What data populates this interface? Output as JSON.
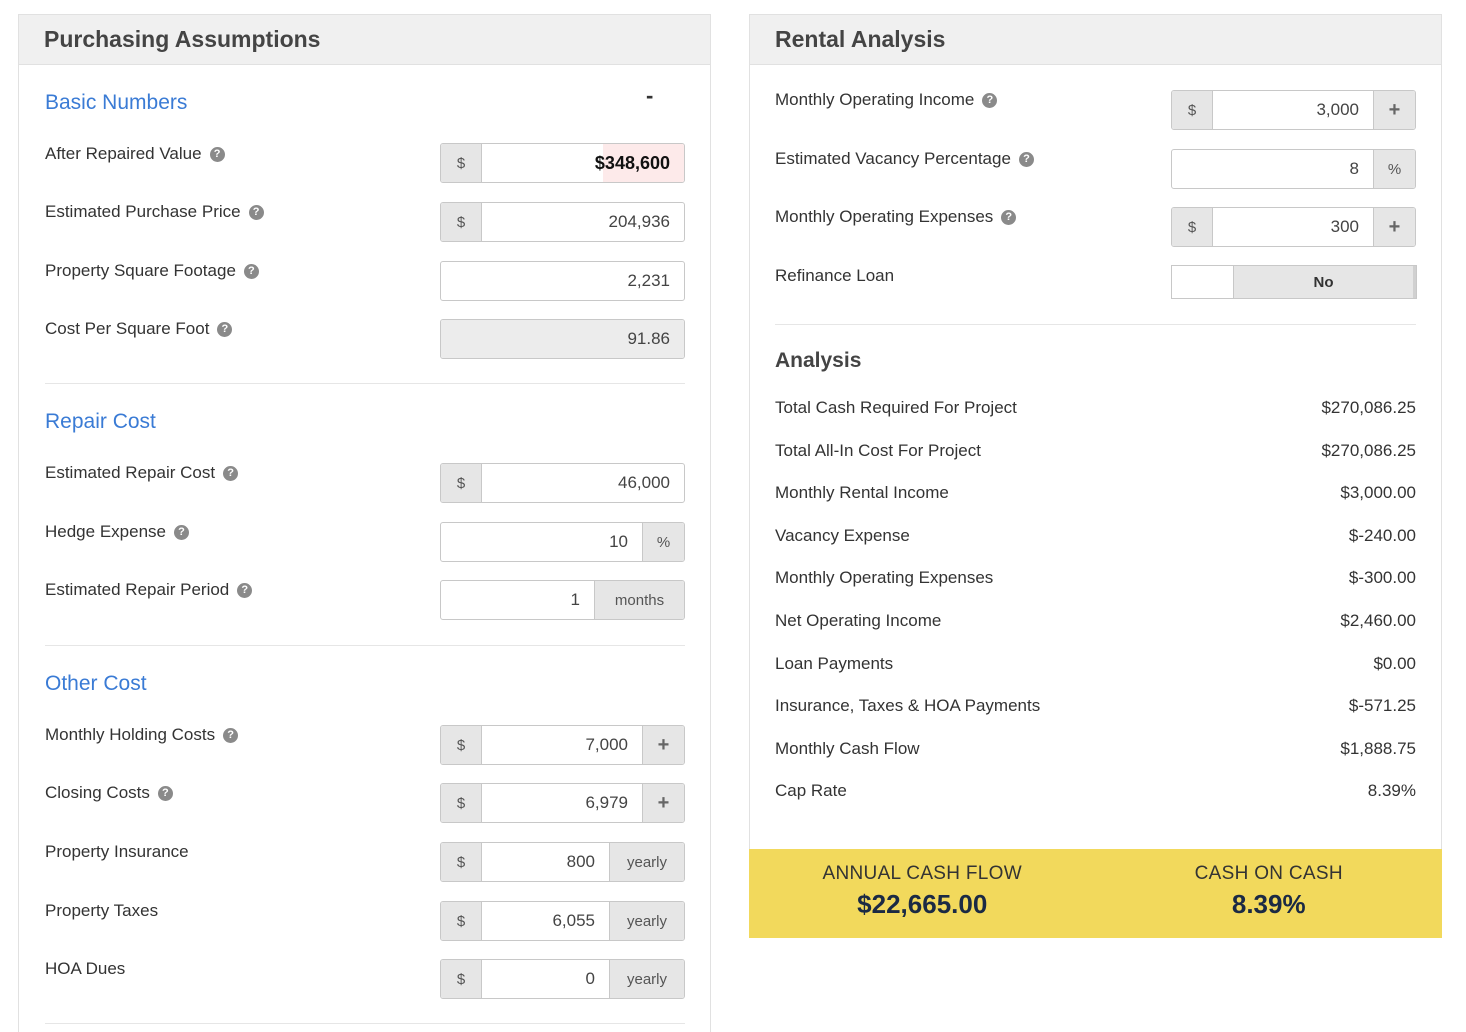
{
  "purchasing": {
    "title": "Purchasing Assumptions",
    "collapse_label": "-",
    "basic": {
      "title": "Basic Numbers",
      "arv_label": "After Repaired Value",
      "arv_prefix": "$",
      "arv_value": "$348,600",
      "purchase_label": "Estimated Purchase Price",
      "purchase_prefix": "$",
      "purchase_value": "204,936",
      "sqft_label": "Property Square Footage",
      "sqft_value": "2,231",
      "cpsf_label": "Cost Per Square Foot",
      "cpsf_value": "91.86"
    },
    "repair": {
      "title": "Repair Cost",
      "cost_label": "Estimated Repair Cost",
      "cost_prefix": "$",
      "cost_value": "46,000",
      "hedge_label": "Hedge Expense",
      "hedge_value": "10",
      "hedge_suffix": "%",
      "period_label": "Estimated Repair Period",
      "period_value": "1",
      "period_suffix": "months"
    },
    "other": {
      "title": "Other Cost",
      "holding_label": "Monthly Holding Costs",
      "holding_prefix": "$",
      "holding_value": "7,000",
      "holding_suffix": "+",
      "closing_label": "Closing Costs",
      "closing_prefix": "$",
      "closing_value": "6,979",
      "closing_suffix": "+",
      "insurance_label": "Property Insurance",
      "insurance_prefix": "$",
      "insurance_value": "800",
      "insurance_suffix": "yearly",
      "taxes_label": "Property Taxes",
      "taxes_prefix": "$",
      "taxes_value": "6,055",
      "taxes_suffix": "yearly",
      "hoa_label": "HOA Dues",
      "hoa_prefix": "$",
      "hoa_value": "0",
      "hoa_suffix": "yearly"
    }
  },
  "rental": {
    "title": "Rental Analysis",
    "income_label": "Monthly Operating Income",
    "income_prefix": "$",
    "income_value": "3,000",
    "income_suffix": "+",
    "vacancy_label": "Estimated Vacancy Percentage",
    "vacancy_value": "8",
    "vacancy_suffix": "%",
    "expenses_label": "Monthly Operating Expenses",
    "expenses_prefix": "$",
    "expenses_value": "300",
    "expenses_suffix": "+",
    "refinance_label": "Refinance Loan",
    "refinance_state": "No"
  },
  "analysis": {
    "title": "Analysis",
    "rows": [
      {
        "label": "Total Cash Required For Project",
        "value": "$270,086.25"
      },
      {
        "label": "Total All-In Cost For Project",
        "value": "$270,086.25"
      },
      {
        "label": "Monthly Rental Income",
        "value": "$3,000.00"
      },
      {
        "label": "Vacancy Expense",
        "value": "$-240.00"
      },
      {
        "label": "Monthly Operating Expenses",
        "value": "$-300.00"
      },
      {
        "label": "Net Operating Income",
        "value": "$2,460.00"
      },
      {
        "label": "Loan Payments",
        "value": "$0.00"
      },
      {
        "label": "Insurance, Taxes & HOA Payments",
        "value": "$-571.25"
      },
      {
        "label": "Monthly Cash Flow",
        "value": "$1,888.75"
      },
      {
        "label": "Cap Rate",
        "value": "8.39%"
      }
    ]
  },
  "summary": {
    "annual_label": "ANNUAL CASH FLOW",
    "annual_value": "$22,665.00",
    "coc_label": "CASH ON CASH",
    "coc_value": "8.39%"
  },
  "colors": {
    "section_blue": "#3a7bd5",
    "summary_yellow": "#f2d95c",
    "summary_text": "#1b2a44"
  }
}
